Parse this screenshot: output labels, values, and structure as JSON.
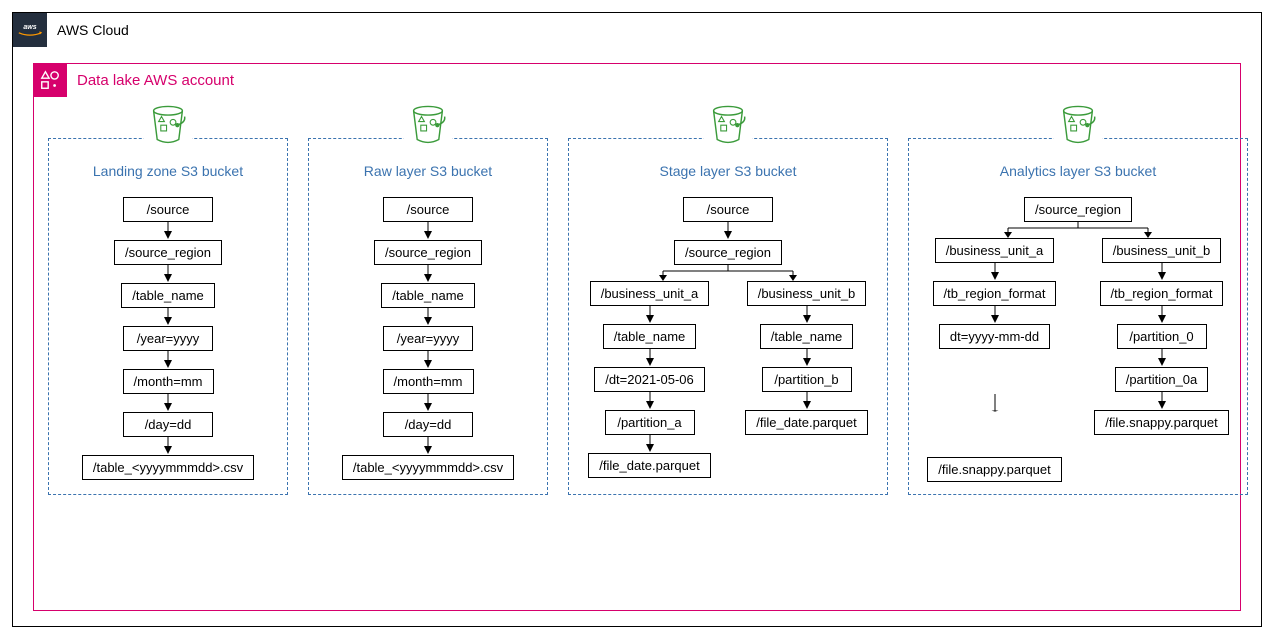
{
  "cloud": {
    "title": "AWS Cloud"
  },
  "account": {
    "title": "Data lake AWS account"
  },
  "buckets": {
    "landing": {
      "title": "Landing zone S3 bucket",
      "chain": [
        "/source",
        "/source_region",
        "/table_name",
        "/year=yyyy",
        "/month=mm",
        "/day=dd",
        "/table_<yyyymmmdd>.csv"
      ]
    },
    "raw": {
      "title": "Raw layer S3 bucket",
      "chain": [
        "/source",
        "/source_region",
        "/table_name",
        "/year=yyyy",
        "/month=mm",
        "/day=dd",
        "/table_<yyyymmmdd>.csv"
      ]
    },
    "stage": {
      "title": "Stage layer S3 bucket",
      "head": [
        "/source",
        "/source_region"
      ],
      "left": [
        "/business_unit_a",
        "/table_name",
        "/dt=2021-05-06",
        "/partition_a",
        "/file_date.parquet"
      ],
      "right": [
        "/business_unit_b",
        "/table_name",
        "/partition_b",
        "/file_date.parquet"
      ]
    },
    "analytics": {
      "title": "Analytics layer S3 bucket",
      "head": [
        "/source_region"
      ],
      "left": [
        "/business_unit_a",
        "/tb_region_format",
        "dt=yyyy-mm-dd",
        "/file.snappy.parquet"
      ],
      "right": [
        "/business_unit_b",
        "/tb_region_format",
        "/partition_0",
        "/partition_0a",
        "/file.snappy.parquet"
      ]
    }
  }
}
